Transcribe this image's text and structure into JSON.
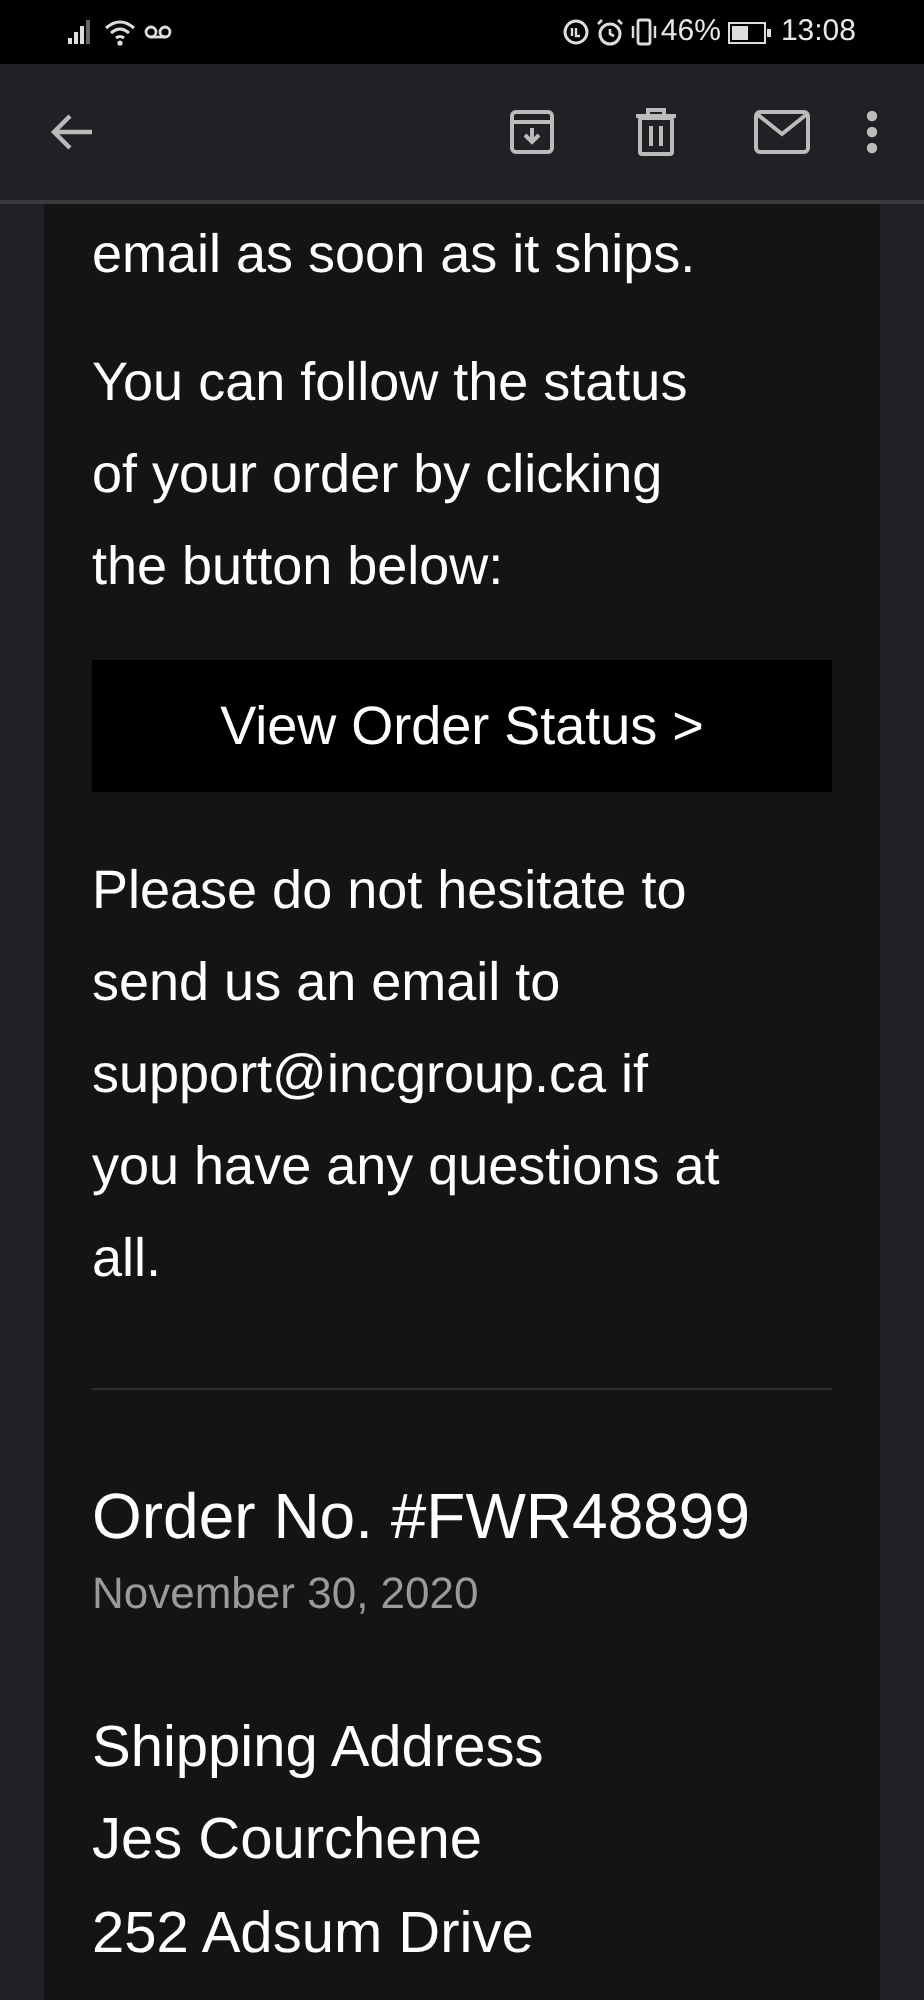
{
  "status_bar": {
    "battery_percent": "46%",
    "time": "13:08"
  },
  "email": {
    "paragraphs_before": [
      "email as soon as it ships.",
      "You can follow the status of your order by clicking the button below:"
    ],
    "button": "View Order Status >",
    "paragraphs_after": [
      "Please do not hesitate to send us an email to support@incgroup.ca if you have any questions at all."
    ],
    "order_number": "Order No. #FWR48899",
    "order_date": "November 30, 2020",
    "shipping_heading": "Shipping Address",
    "address_lines": [
      "Jes Courchene",
      "252 Adsum Drive"
    ]
  }
}
